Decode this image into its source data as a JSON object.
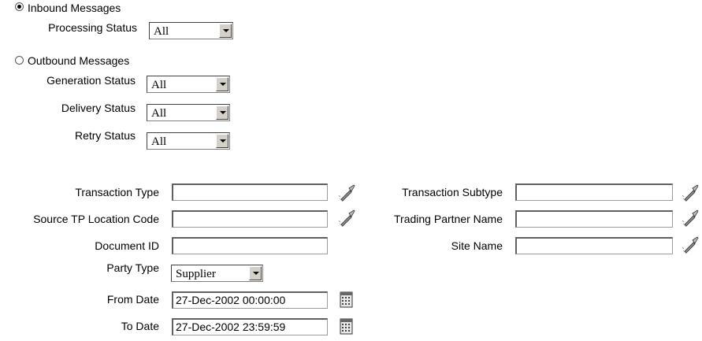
{
  "inbound": {
    "radio_label": "Inbound Messages",
    "checked": true,
    "processing_status_label": "Processing Status",
    "processing_status_value": "All"
  },
  "outbound": {
    "radio_label": "Outbound Messages",
    "checked": false,
    "generation_status_label": "Generation Status",
    "generation_status_value": "All",
    "delivery_status_label": "Delivery Status",
    "delivery_status_value": "All",
    "retry_status_label": "Retry Status",
    "retry_status_value": "All"
  },
  "fields": {
    "transaction_type_label": "Transaction Type",
    "transaction_type_value": "",
    "source_tp_label": "Source TP Location Code",
    "source_tp_value": "",
    "document_id_label": "Document ID",
    "document_id_value": "",
    "party_type_label": "Party Type",
    "party_type_value": "Supplier",
    "from_date_label": "From Date",
    "from_date_value": "27-Dec-2002 00:00:00",
    "to_date_label": "To Date",
    "to_date_value": "27-Dec-2002 23:59:59",
    "transaction_subtype_label": "Transaction Subtype",
    "transaction_subtype_value": "",
    "trading_partner_label": "Trading Partner Name",
    "trading_partner_value": "",
    "site_name_label": "Site Name",
    "site_name_value": ""
  },
  "icons": {
    "lov": "flashlight-icon",
    "calendar": "calendar-icon"
  }
}
